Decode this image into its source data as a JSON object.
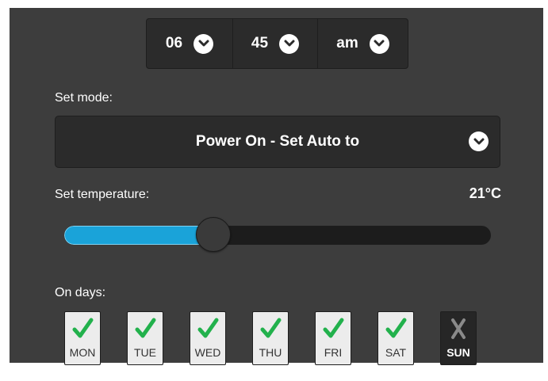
{
  "time": {
    "hour": "06",
    "minute": "45",
    "ampm": "am"
  },
  "mode": {
    "label": "Set mode:",
    "value": "Power On - Set Auto to"
  },
  "temperature": {
    "label": "Set temperature:",
    "value": "21°C",
    "slider_fraction": 0.35
  },
  "days": {
    "label": "On days:",
    "items": [
      {
        "label": "MON",
        "enabled": true
      },
      {
        "label": "TUE",
        "enabled": true
      },
      {
        "label": "WED",
        "enabled": true
      },
      {
        "label": "THU",
        "enabled": true
      },
      {
        "label": "FRI",
        "enabled": true
      },
      {
        "label": "SAT",
        "enabled": true
      },
      {
        "label": "SUN",
        "enabled": false
      }
    ]
  },
  "colors": {
    "panel_bg": "#3d3d3d",
    "accent": "#1aa3d9",
    "check_green": "#22b14c",
    "cross_gray": "#8a8a8a"
  },
  "icons": {
    "dropdown": "chevron-down-icon",
    "day_on": "checkmark-icon",
    "day_off": "cross-icon"
  }
}
